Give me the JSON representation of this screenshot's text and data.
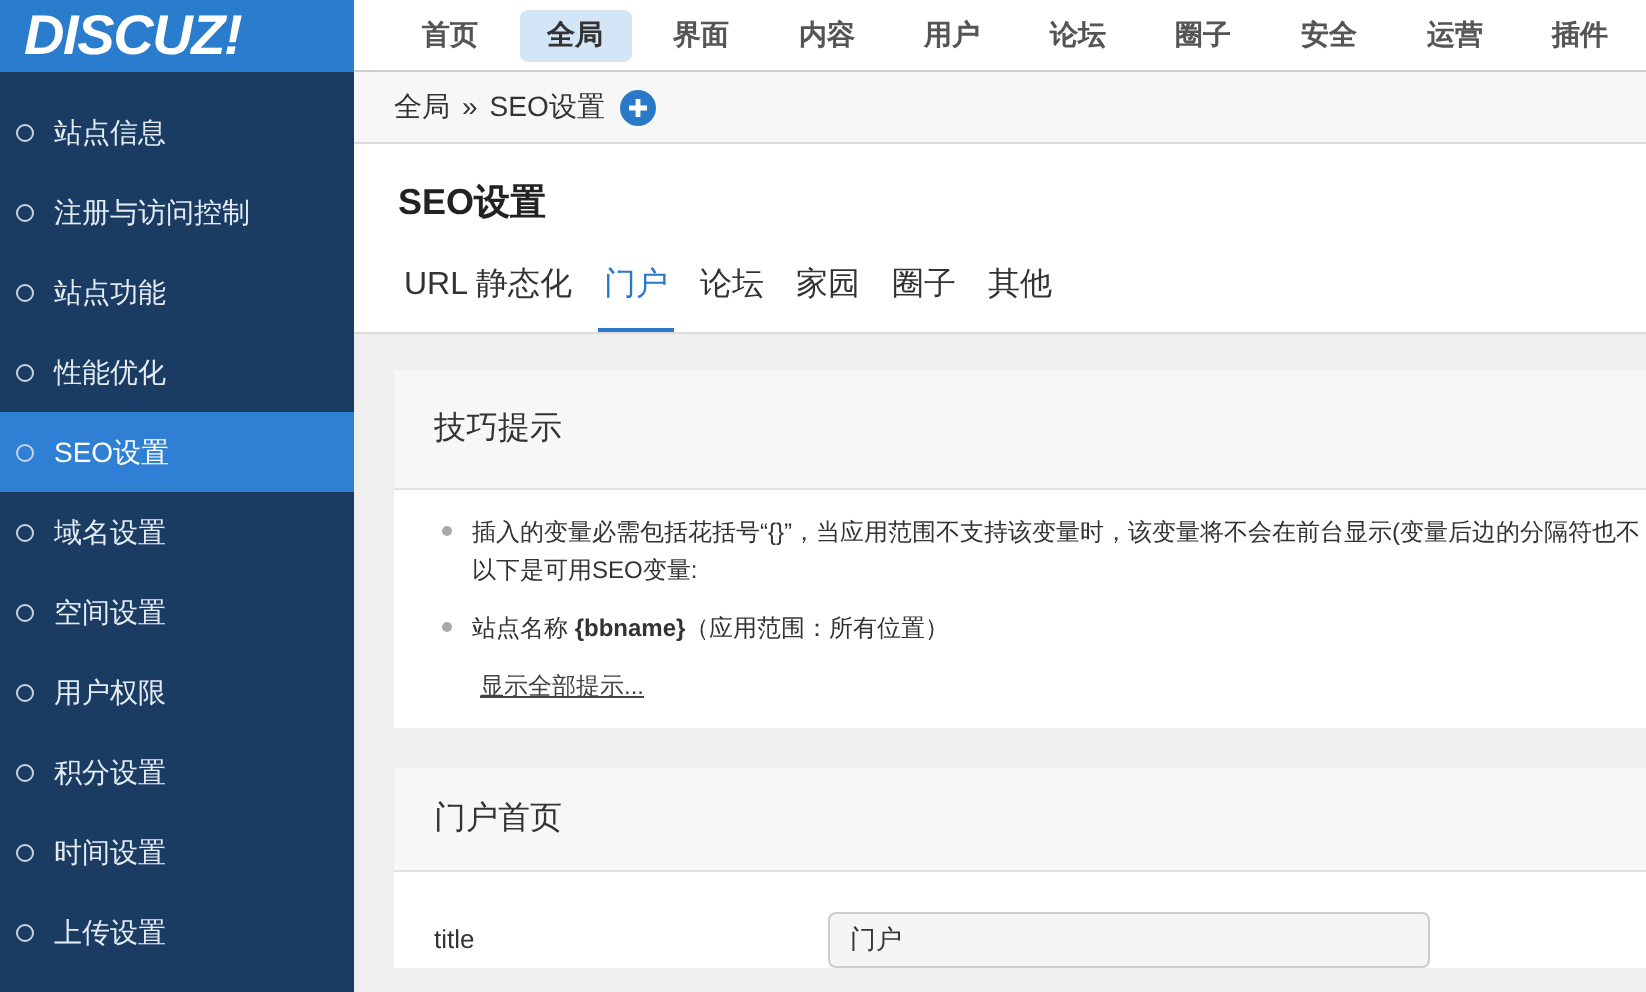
{
  "logo": {
    "text": "DISCUZ!"
  },
  "top_nav": [
    {
      "label": "首页",
      "selected": false
    },
    {
      "label": "全局",
      "selected": true
    },
    {
      "label": "界面",
      "selected": false
    },
    {
      "label": "内容",
      "selected": false
    },
    {
      "label": "用户",
      "selected": false
    },
    {
      "label": "论坛",
      "selected": false
    },
    {
      "label": "圈子",
      "selected": false
    },
    {
      "label": "安全",
      "selected": false
    },
    {
      "label": "运营",
      "selected": false
    },
    {
      "label": "插件",
      "selected": false
    }
  ],
  "sidebar": {
    "items": [
      {
        "label": "站点信息",
        "selected": false
      },
      {
        "label": "注册与访问控制",
        "selected": false
      },
      {
        "label": "站点功能",
        "selected": false
      },
      {
        "label": "性能优化",
        "selected": false
      },
      {
        "label": "SEO设置",
        "selected": true
      },
      {
        "label": "域名设置",
        "selected": false
      },
      {
        "label": "空间设置",
        "selected": false
      },
      {
        "label": "用户权限",
        "selected": false
      },
      {
        "label": "积分设置",
        "selected": false
      },
      {
        "label": "时间设置",
        "selected": false
      },
      {
        "label": "上传设置",
        "selected": false
      }
    ]
  },
  "breadcrumb": {
    "parent": "全局",
    "separator": "»",
    "current": "SEO设置"
  },
  "page_title": "SEO设置",
  "tabs": [
    {
      "label": "URL 静态化",
      "selected": false
    },
    {
      "label": "门户",
      "selected": true
    },
    {
      "label": "论坛",
      "selected": false
    },
    {
      "label": "家园",
      "selected": false
    },
    {
      "label": "圈子",
      "selected": false
    },
    {
      "label": "其他",
      "selected": false
    }
  ],
  "tips": {
    "title": "技巧提示",
    "items": [
      {
        "lines": [
          "插入的变量必需包括花括号“{}”，当应用范围不支持该变量时，该变量将不会在前台显示(变量后边的分隔符也不",
          "以下是可用SEO变量:"
        ]
      },
      {
        "lines": [
          "站点名称 **{bbname}**（应用范围：所有位置）"
        ]
      }
    ],
    "link": "显示全部提示..."
  },
  "section": {
    "title": "门户首页",
    "fields": [
      {
        "label": "title",
        "value": "门户"
      }
    ]
  }
}
